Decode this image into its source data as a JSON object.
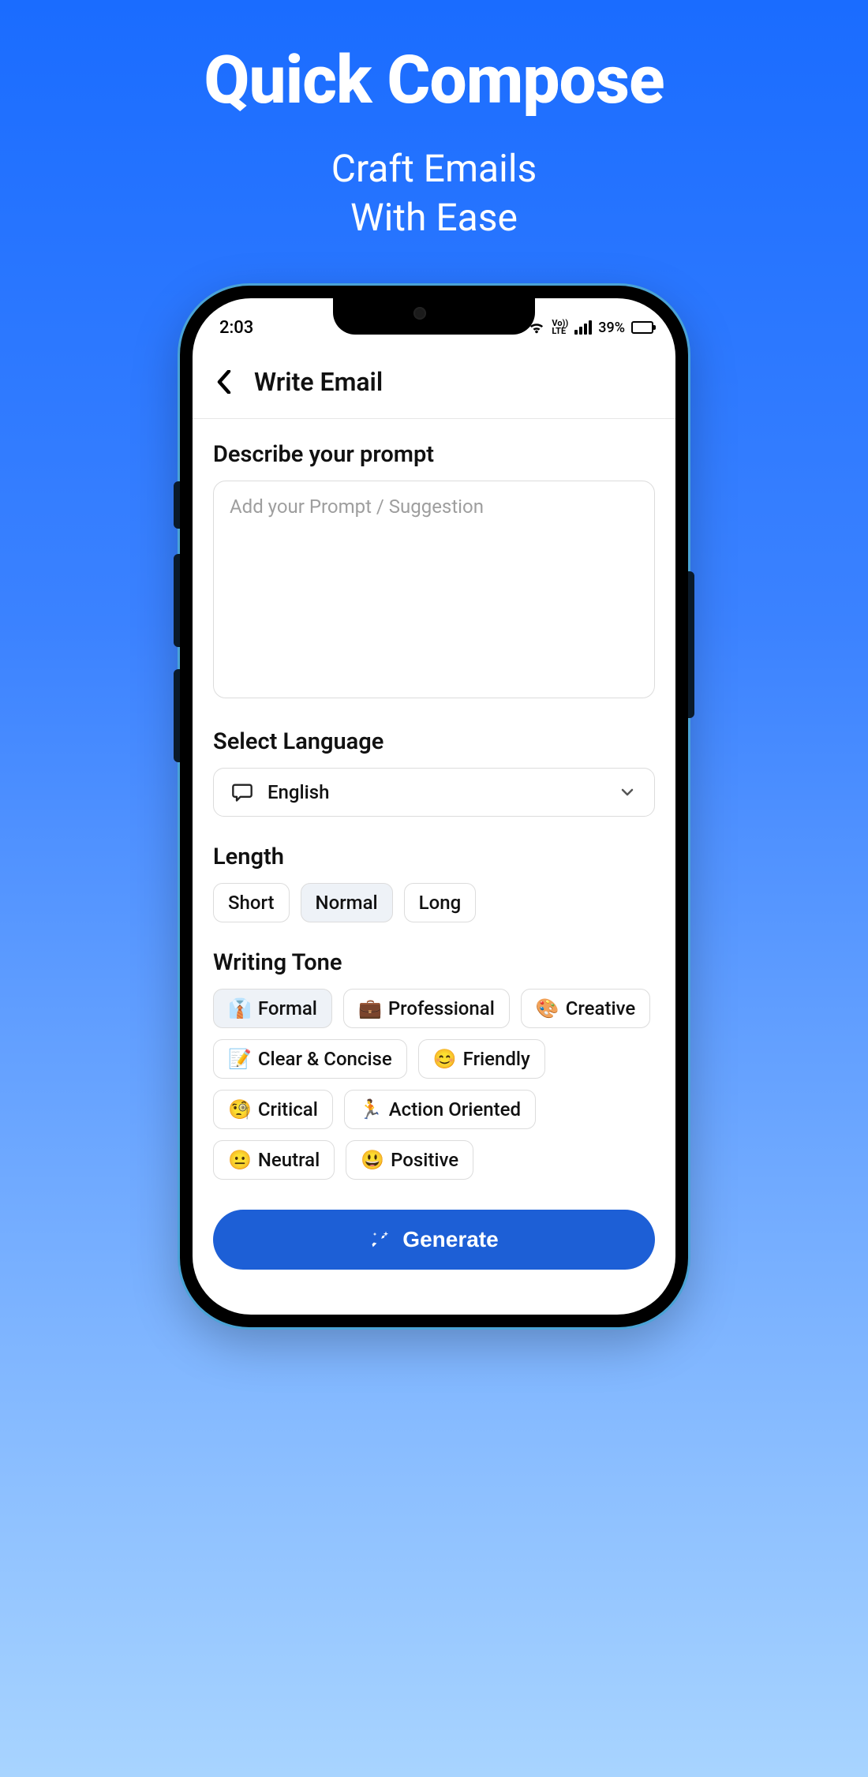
{
  "promo": {
    "title": "Quick Compose",
    "subtitle_line1": "Craft Emails",
    "subtitle_line2": "With Ease"
  },
  "status": {
    "time": "2:03",
    "network_label": "Vo))\nLTE",
    "battery_text": "39%"
  },
  "header": {
    "title": "Write Email"
  },
  "prompt": {
    "label": "Describe your prompt",
    "placeholder": "Add your Prompt / Suggestion",
    "value": ""
  },
  "language": {
    "label": "Select Language",
    "selected": "English"
  },
  "length": {
    "label": "Length",
    "options": [
      "Short",
      "Normal",
      "Long"
    ],
    "selected_index": 1
  },
  "tone": {
    "label": "Writing Tone",
    "options": [
      {
        "emoji": "👔",
        "label": "Formal",
        "selected": true
      },
      {
        "emoji": "💼",
        "label": "Professional",
        "selected": false
      },
      {
        "emoji": "🎨",
        "label": "Creative",
        "selected": false
      },
      {
        "emoji": "📝",
        "label": "Clear & Concise",
        "selected": false
      },
      {
        "emoji": "😊",
        "label": "Friendly",
        "selected": false
      },
      {
        "emoji": "🧐",
        "label": "Critical",
        "selected": false
      },
      {
        "emoji": "🏃",
        "label": "Action Oriented",
        "selected": false
      },
      {
        "emoji": "😐",
        "label": "Neutral",
        "selected": false
      },
      {
        "emoji": "😃",
        "label": "Positive",
        "selected": false
      }
    ]
  },
  "generate": {
    "label": "Generate"
  }
}
